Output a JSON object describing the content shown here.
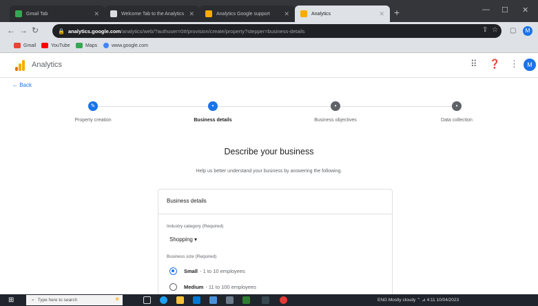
{
  "browser": {
    "tabs": [
      {
        "label": "Gmail Tab",
        "favicon_color": "#34a853"
      },
      {
        "label": "Welcome Tab to the Analytics",
        "favicon_color": "#dadce0"
      },
      {
        "label": "Analytics Google support",
        "favicon_color": "#f9ab00"
      },
      {
        "label": "Analytics",
        "favicon_color": "#f9ab00"
      }
    ],
    "new_tab_icon": "+",
    "window_controls": [
      "—",
      "☐",
      "✕"
    ],
    "address": {
      "host": "analytics.google.com",
      "path": "/analytics/web/?authuser=0#/provision/create/property?stepper=business-details"
    },
    "bookmarks": [
      {
        "label": "Gmail",
        "color": "#ea4335"
      },
      {
        "label": "YouTube",
        "color": "#ff0000"
      },
      {
        "label": "Maps",
        "color": "#34a853"
      },
      {
        "label": "www.google.com",
        "color": "#4285f4"
      }
    ],
    "profile_initial": "M"
  },
  "app": {
    "title": "Analytics",
    "avatar_initial": "M",
    "back_label": "← Back"
  },
  "stepper": {
    "steps": [
      {
        "label": "Property creation",
        "state": "done"
      },
      {
        "label": "Business details",
        "state": "current"
      },
      {
        "label": "Business objectives",
        "state": "pending"
      },
      {
        "label": "Data collection",
        "state": "pending"
      }
    ]
  },
  "main": {
    "heading": "Describe your business",
    "subheading": "Help us better understand your business by answering the following.",
    "card": {
      "title": "Business details",
      "category_label": "Industry category (Required)",
      "category_value": "Shopping ▾",
      "size_label": "Business size (Required)",
      "sizes": [
        {
          "name": "Small",
          "detail": "- 1 to 10 employees",
          "checked": true
        },
        {
          "name": "Medium",
          "detail": "- 11 to 100 employees",
          "checked": false
        }
      ]
    }
  },
  "taskbar": {
    "search_placeholder": "Type here to search",
    "tray_text": "ENG  Mostly cloudy   ⌃  ⊿  4:11  10/04/2023"
  },
  "colors": {
    "accent": "#1a73e8",
    "pending": "#5f6368"
  }
}
